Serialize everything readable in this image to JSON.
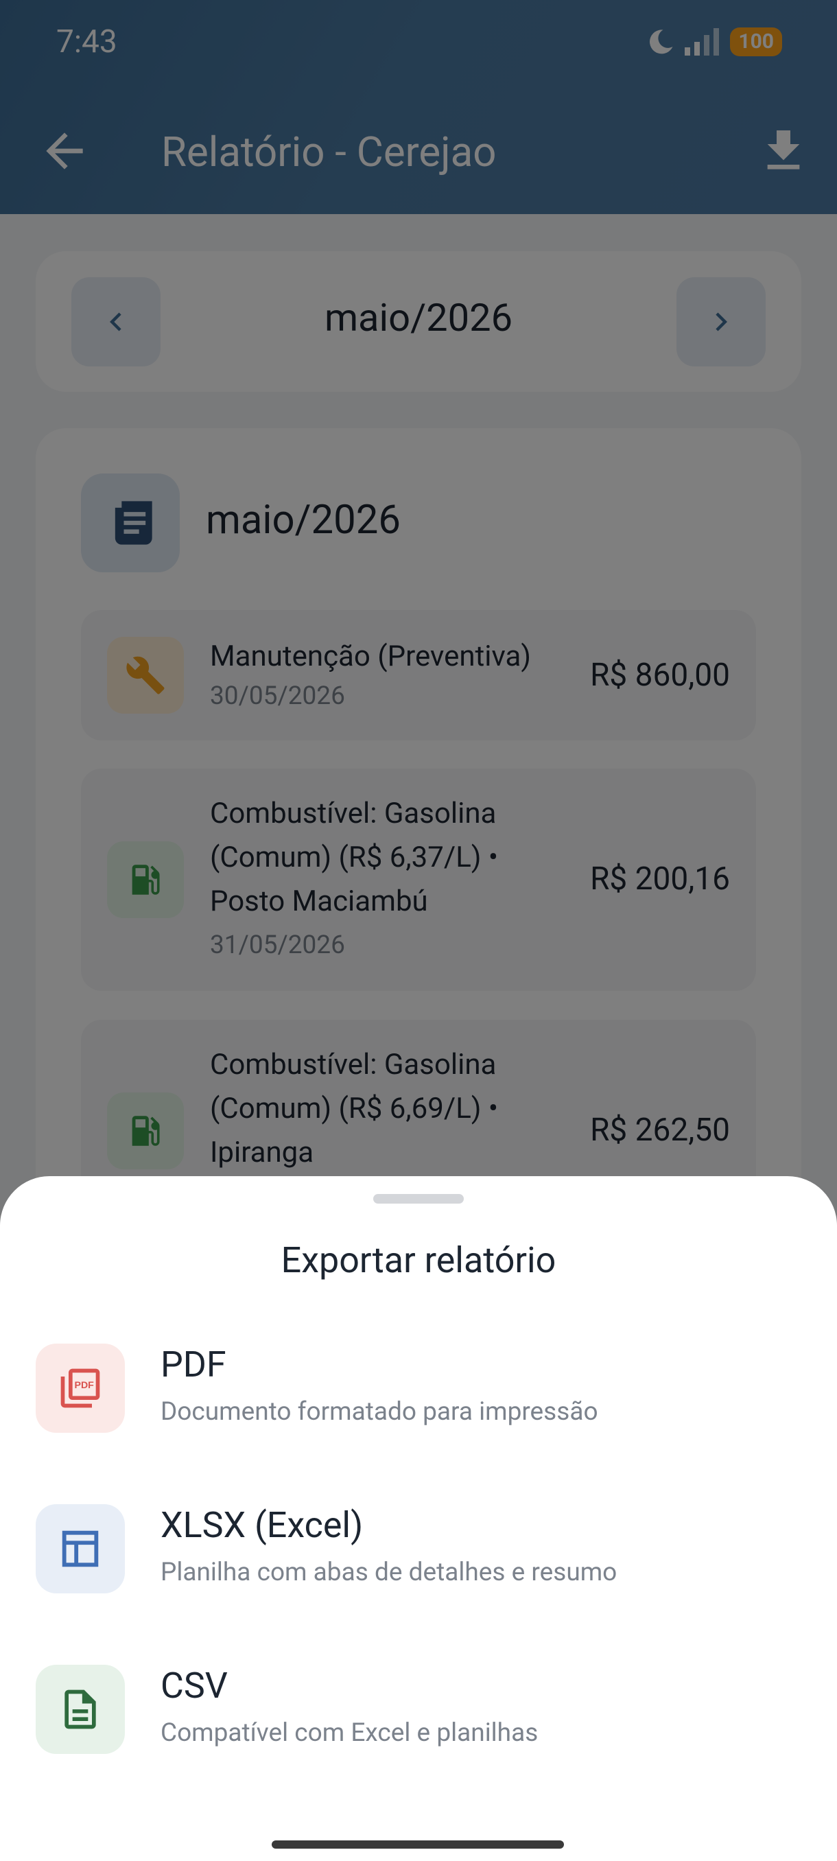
{
  "status_bar": {
    "time": "7:43",
    "battery": "100"
  },
  "header": {
    "title": "Relatório - Cerejao"
  },
  "month_nav": {
    "label": "maio/2026"
  },
  "report": {
    "title": "maio/2026",
    "entries": [
      {
        "title_lines": [
          "Manutenção (Preventiva)"
        ],
        "date": "30/05/2026",
        "amount": "R$ 860,00",
        "icon": "wrench-icon"
      },
      {
        "title_lines": [
          "Combustível: Gasolina",
          "(Comum) (R$ 6,37/L) •",
          "Posto Maciambú"
        ],
        "date": "31/05/2026",
        "amount": "R$ 200,16",
        "icon": "fuel-pump-icon"
      },
      {
        "title_lines": [
          "Combustível: Gasolina",
          "(Comum) (R$ 6,69/L) •",
          "Ipiranga"
        ],
        "date": "",
        "amount": "R$ 262,50",
        "icon": "fuel-pump-icon"
      }
    ]
  },
  "export_sheet": {
    "title": "Exportar relatório",
    "options": [
      {
        "label": "PDF",
        "description": "Documento formatado para impressão",
        "icon": "pdf-icon",
        "color": "#d9534f"
      },
      {
        "label": "XLSX (Excel)",
        "description": "Planilha com abas de detalhes e resumo",
        "icon": "table-icon",
        "color": "#3f6eb5"
      },
      {
        "label": "CSV",
        "description": "Compatível com Excel e planilhas",
        "icon": "document-icon",
        "color": "#2e6b3d"
      }
    ]
  },
  "colors": {
    "header": "#4b7aa2",
    "battery": "#ffa31a",
    "wrench": "#f0a020",
    "fuel": "#3a9a4a"
  }
}
